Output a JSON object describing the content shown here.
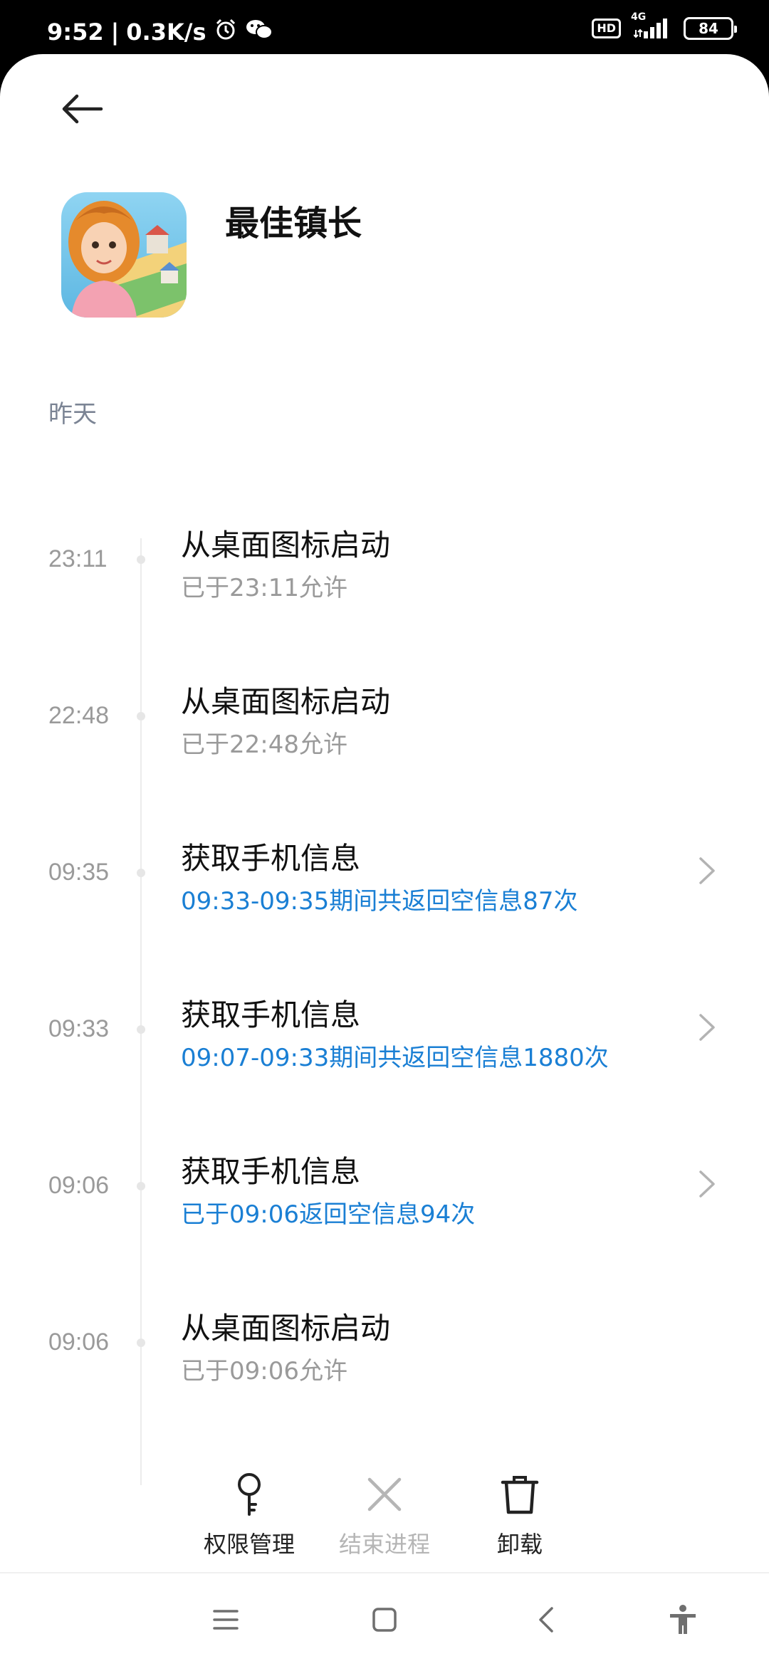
{
  "status_bar": {
    "time": "9:52",
    "speed": "0.3K/s",
    "network_type": "4G",
    "hd_label": "HD",
    "battery": "84"
  },
  "app": {
    "name": "最佳镇长"
  },
  "section": {
    "label": "昨天"
  },
  "entries": [
    {
      "time": "23:11",
      "title": "从桌面图标启动",
      "subtitle": "已于23:11允许",
      "subtitle_style": "gray",
      "has_chevron": false
    },
    {
      "time": "22:48",
      "title": "从桌面图标启动",
      "subtitle": "已于22:48允许",
      "subtitle_style": "gray",
      "has_chevron": false
    },
    {
      "time": "09:35",
      "title": "获取手机信息",
      "subtitle": "09:33-09:35期间共返回空信息87次",
      "subtitle_style": "blue",
      "has_chevron": true
    },
    {
      "time": "09:33",
      "title": "获取手机信息",
      "subtitle": "09:07-09:33期间共返回空信息1880次",
      "subtitle_style": "blue",
      "has_chevron": true
    },
    {
      "time": "09:06",
      "title": "获取手机信息",
      "subtitle": "已于09:06返回空信息94次",
      "subtitle_style": "blue",
      "has_chevron": true
    },
    {
      "time": "09:06",
      "title": "从桌面图标启动",
      "subtitle": "已于09:06允许",
      "subtitle_style": "gray",
      "has_chevron": false
    }
  ],
  "actions": {
    "permissions": "权限管理",
    "end_process": "结束进程",
    "uninstall": "卸载"
  },
  "colors": {
    "accent_blue": "#1a7fd4",
    "muted_gray": "#9a9a9a",
    "section_gray": "#7b8494"
  },
  "icons": {
    "back": "arrow-left-icon",
    "chevron": "chevron-right-icon",
    "permissions": "key-icon",
    "end_process": "close-x-icon",
    "uninstall": "trash-icon",
    "nav_menu": "menu-icon",
    "nav_home": "home-square-icon",
    "nav_back": "back-chevron-icon",
    "nav_accessibility": "accessibility-icon"
  }
}
